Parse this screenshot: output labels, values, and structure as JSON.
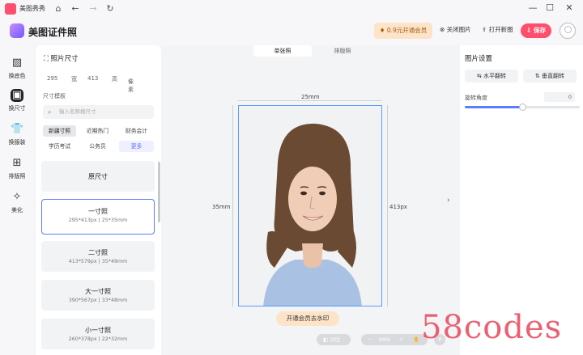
{
  "titlebar": {
    "app_name": "美图秀秀"
  },
  "header": {
    "brand_title": "美图证件照",
    "vip_label": "0.9元开通会员",
    "close_image_label": "关闭图片",
    "open_new_label": "打开新图",
    "save_label": "保存"
  },
  "leftnav": {
    "items": [
      {
        "label": "换底色"
      },
      {
        "label": "换尺寸"
      },
      {
        "label": "换服装"
      },
      {
        "label": "排版照"
      },
      {
        "label": "美化"
      }
    ]
  },
  "panel": {
    "title": "照片尺寸",
    "width_value": "295",
    "width_unit": "宽",
    "height_value": "413",
    "height_unit": "高",
    "unit_select": "像素",
    "section_label": "尺寸模板",
    "search_placeholder": "输入名称搜尺寸",
    "tags": [
      "新疆寸照",
      "近期热门",
      "财务会计",
      "学历考试",
      "公务员",
      "更多"
    ],
    "cards": [
      {
        "name": "原尺寸",
        "spec": ""
      },
      {
        "name": "一寸照",
        "spec": "295*413px | 25*35mm"
      },
      {
        "name": "二寸照",
        "spec": "413*579px | 35*49mm"
      },
      {
        "name": "大一寸照",
        "spec": "390*567px | 33*48mm"
      },
      {
        "name": "小一寸照",
        "spec": "260*378px | 22*32mm"
      }
    ]
  },
  "canvas": {
    "tabs": [
      "单张照",
      "排版照"
    ],
    "width_mm": "25mm",
    "height_mm": "35mm",
    "height_px": "413px",
    "watermark_btn": "开通会员去水印",
    "compare_label": "对比",
    "zoom_value": "99%",
    "help_label": "?"
  },
  "right_panel": {
    "title": "图片设置",
    "flip_h": "水平翻转",
    "flip_v": "垂直翻转",
    "rotation_label": "旋转角度",
    "rotation_value": "0"
  },
  "site_watermark": "58codes"
}
